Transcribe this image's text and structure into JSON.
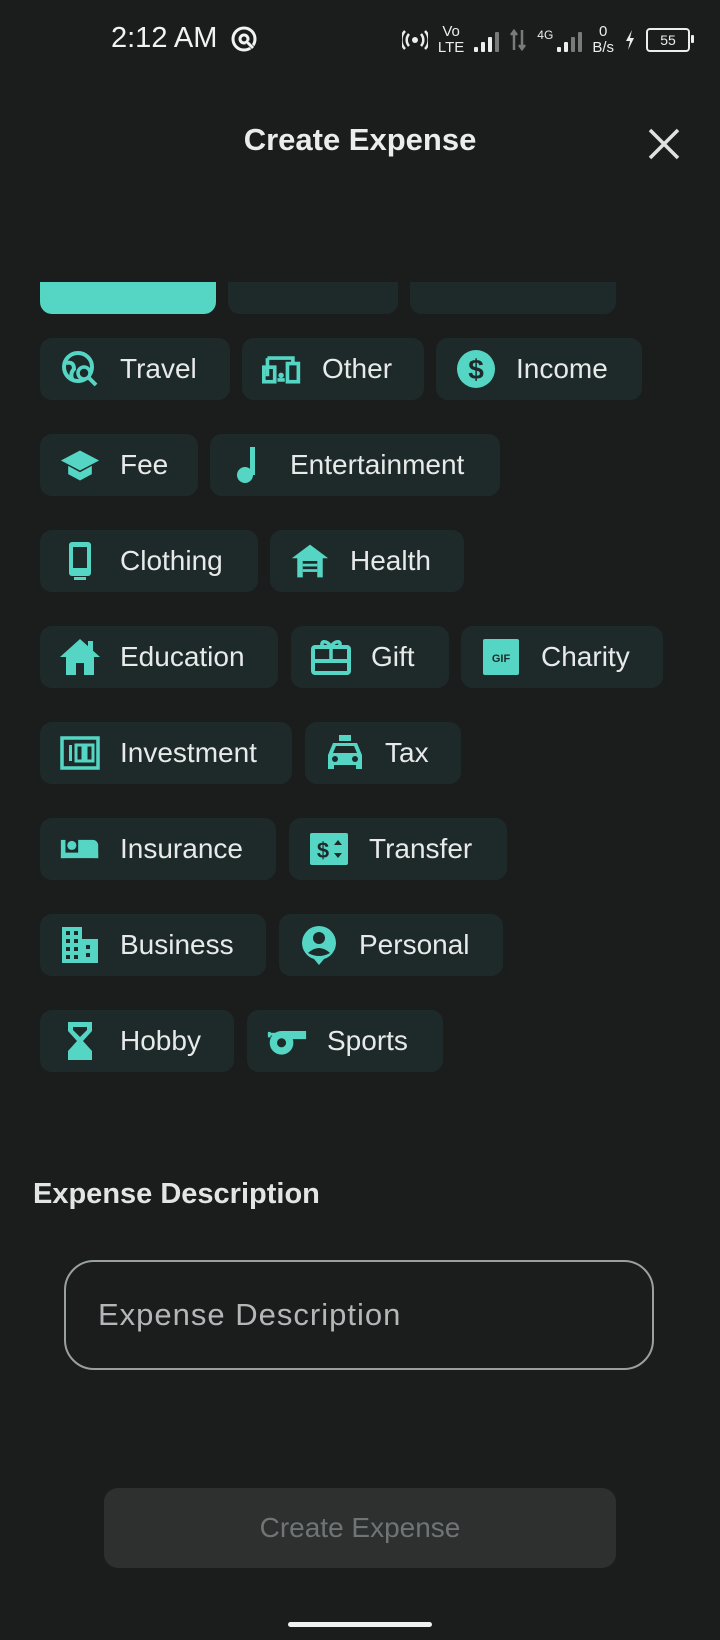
{
  "status_bar": {
    "time": "2:12 AM",
    "volte_top": "Vo",
    "volte_bottom": "LTE",
    "network": "4G",
    "speed_value": "0",
    "speed_unit": "B/s",
    "battery": "55"
  },
  "header": {
    "title": "Create Expense",
    "close_icon": "close-icon"
  },
  "accent_color": "#55d6c4",
  "categories": [
    {
      "label": "Travel",
      "icon": "travel-explore-icon"
    },
    {
      "label": "Other",
      "icon": "devices-icon"
    },
    {
      "label": "Income",
      "icon": "dollar-circle-icon"
    },
    {
      "label": "Fee",
      "icon": "graduation-cap-icon"
    },
    {
      "label": "Entertainment",
      "icon": "music-note-icon"
    },
    {
      "label": "Clothing",
      "icon": "phone-icon"
    },
    {
      "label": "Health",
      "icon": "house-siding-icon"
    },
    {
      "label": "Education",
      "icon": "home-icon"
    },
    {
      "label": "Gift",
      "icon": "gift-card-icon"
    },
    {
      "label": "Charity",
      "icon": "gif-icon"
    },
    {
      "label": "Investment",
      "icon": "counter-100-icon"
    },
    {
      "label": "Tax",
      "icon": "taxi-icon"
    },
    {
      "label": "Insurance",
      "icon": "hotel-bed-icon"
    },
    {
      "label": "Transfer",
      "icon": "price-change-icon"
    },
    {
      "label": "Business",
      "icon": "apartment-icon"
    },
    {
      "label": "Personal",
      "icon": "person-pin-icon"
    },
    {
      "label": "Hobby",
      "icon": "hourglass-icon"
    },
    {
      "label": "Sports",
      "icon": "whistle-icon"
    }
  ],
  "description": {
    "label": "Expense Description",
    "placeholder": "Expense Description",
    "value": ""
  },
  "submit_label": "Create Expense"
}
